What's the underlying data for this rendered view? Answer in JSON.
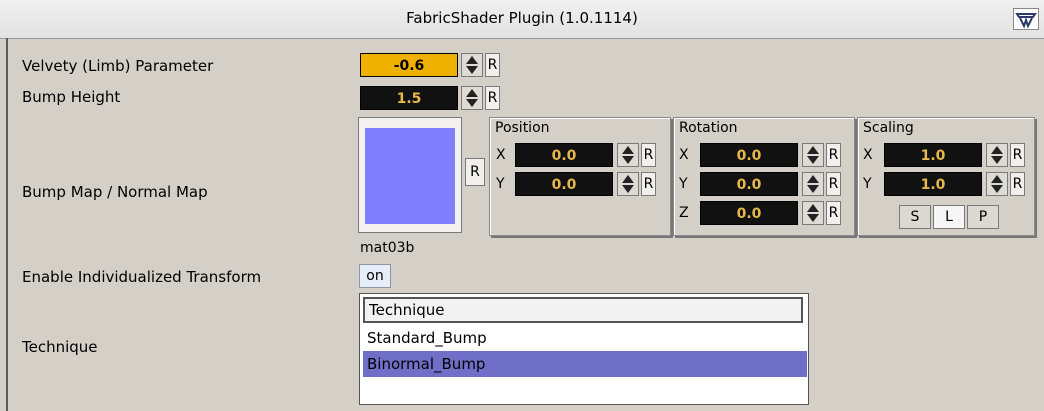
{
  "window": {
    "title": "FabricShader Plugin (1.0.1114)",
    "title_icon": "plugin-icon"
  },
  "params": {
    "velvety": {
      "label": "Velvety (Limb) Parameter",
      "value": "-0.6",
      "reset": "R"
    },
    "bump_height": {
      "label": "Bump Height",
      "value": "1.5",
      "reset": "R"
    },
    "bump_map": {
      "label": "Bump Map / Normal Map",
      "reset": "R",
      "swatch_color": "#7f7fff",
      "texture_name": "mat03b"
    }
  },
  "transform": {
    "position": {
      "title": "Position",
      "x": "0.0",
      "y": "0.0"
    },
    "rotation": {
      "title": "Rotation",
      "x": "0.0",
      "y": "0.0",
      "z": "0.0"
    },
    "scaling": {
      "title": "Scaling",
      "x": "1.0",
      "y": "1.0",
      "modes": [
        "S",
        "L",
        "P"
      ],
      "active_mode": "L"
    },
    "axis_labels": {
      "x": "X",
      "y": "Y",
      "z": "Z"
    },
    "reset": "R"
  },
  "individual": {
    "label": "Enable Individualized Transform",
    "value": "on"
  },
  "technique": {
    "label": "Technique",
    "header": "Technique",
    "options": [
      "Standard_Bump",
      "Binormal_Bump"
    ],
    "selected": "Binormal_Bump"
  },
  "colors": {
    "background": "#d4d0c8",
    "field_bg": "#111111",
    "field_text": "#e8b84a",
    "active_field": "#f0b000",
    "selection": "#6f6fc8"
  }
}
